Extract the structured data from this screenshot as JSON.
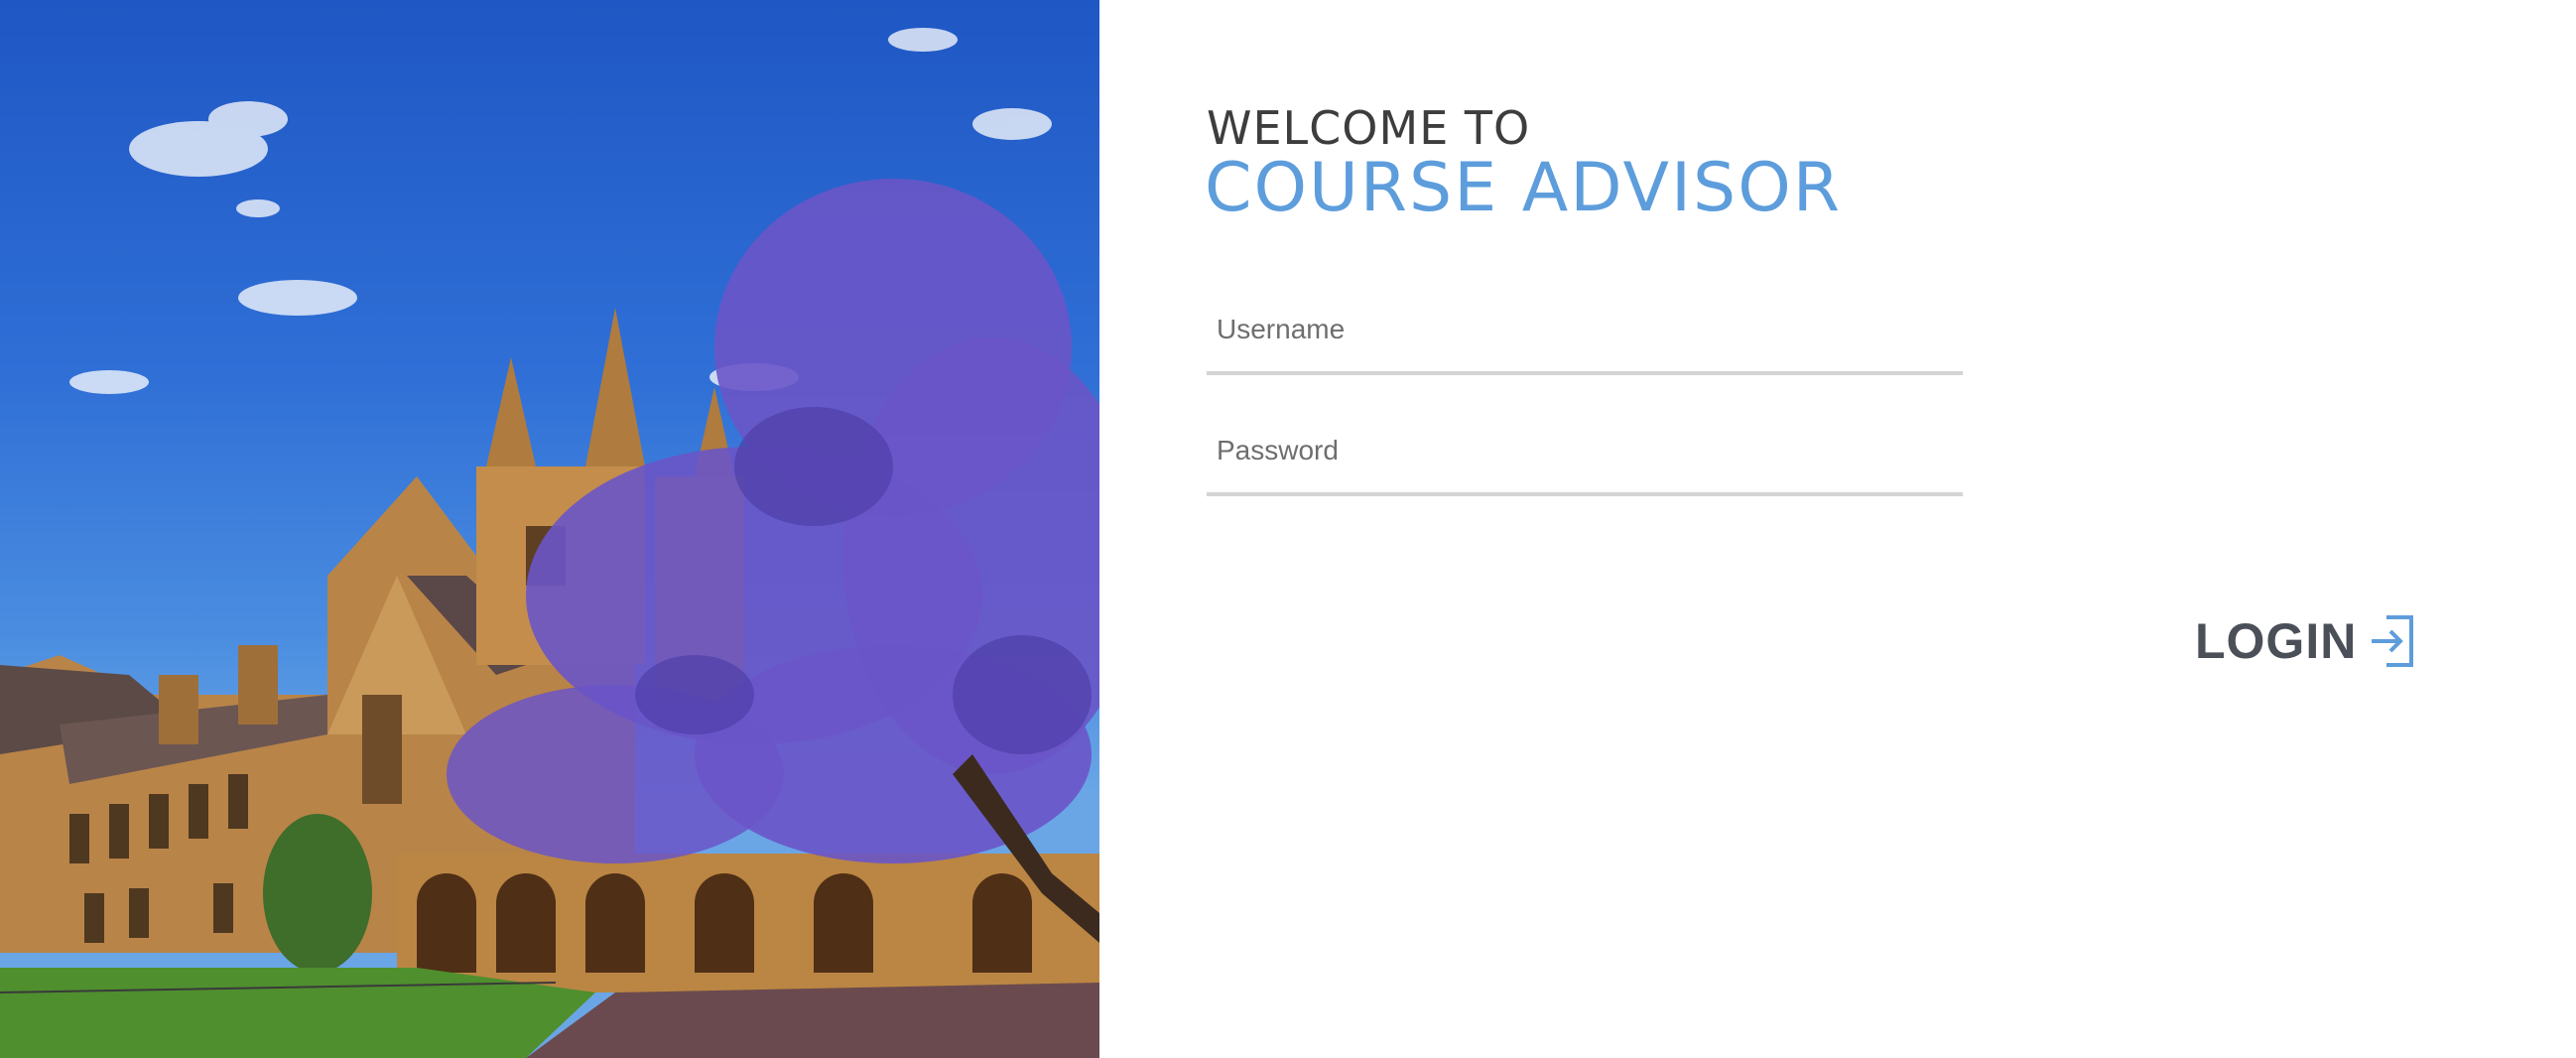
{
  "header": {
    "welcome": "WELCOME TO",
    "title": "COURSE ADVISOR"
  },
  "form": {
    "username_placeholder": "Username",
    "password_placeholder": "Password",
    "login_label": "LOGIN"
  },
  "icons": {
    "login": "sign-in-arrow-icon"
  },
  "colors": {
    "title": "#5d9ddc",
    "welcome": "#3d3d3d",
    "login_text": "#4a4f58",
    "login_icon": "#5d9ddc",
    "field_underline": "#d4d4d4",
    "sky": "#2f6fd6",
    "jacaranda": "#6a55c8",
    "sandstone": "#c8954f",
    "lawn": "#4f8f2e"
  }
}
